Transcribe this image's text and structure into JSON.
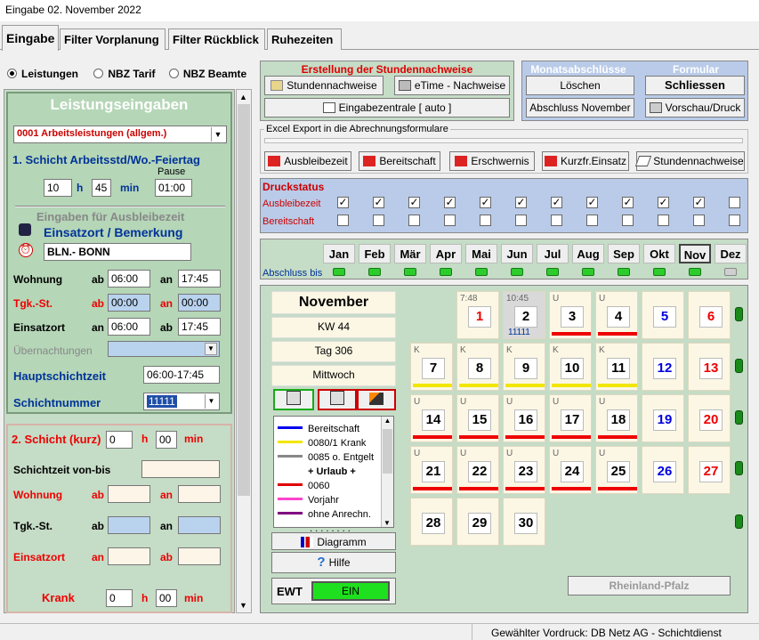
{
  "window": {
    "title": "Eingabe  02. November 2022"
  },
  "tabs": [
    "Eingabe",
    "Filter Vorplanung",
    "Filter Rückblick",
    "Ruhezeiten"
  ],
  "radios": {
    "options": [
      "Leistungen",
      "NBZ Tarif",
      "NBZ Beamte"
    ],
    "selected": "Leistungen"
  },
  "left": {
    "heading": "Leistungseingaben",
    "type_select": "0001 Arbeitsleistungen (allgem.)",
    "schicht1_label": "1. Schicht  Arbeitsstd/Wo.-Feiertag",
    "pause_label": "Pause",
    "hours": "10",
    "h": "h",
    "minutes": "45",
    "min": "min",
    "pause": "01:00",
    "ausbleibe_label": "Eingaben für Ausbleibezeit",
    "einsatzort_label": "Einsatzort / Bemerkung",
    "einsatzort_value": "BLN.- BONN",
    "wohnung": "Wohnung",
    "ab": "ab",
    "an": "an",
    "wohnung_ab": "06:00",
    "wohnung_an": "17:45",
    "tgk": "Tgk.-St.",
    "tgk_ab": "00:00",
    "tgk_an": "00:00",
    "einsatzort": "Einsatzort",
    "einsatz_an": "06:00",
    "einsatz_ab": "17:45",
    "uebernachtungen": "Übernachtungen",
    "hauptschicht": "Hauptschichtzeit",
    "hauptschicht_value": "06:00-17:45",
    "schichtnummer": "Schichtnummer",
    "schichtnummer_value": "11111",
    "schicht2_label": "2. Schicht (kurz)",
    "schicht2_h_val": "0",
    "schicht2_min_val": "00",
    "schichtzeit": "Schichtzeit von-bis",
    "krank": "Krank",
    "krank_h_val": "0",
    "krank_min_val": "00"
  },
  "stundennachweise": {
    "title": "Erstellung der Stundennachweise",
    "btn1": "Stundennachweise",
    "btn2": "eTime - Nachweise",
    "btn3": "Eingabezentrale [ auto  ]"
  },
  "monatsabschluss": {
    "title": "Monatsabschlüsse",
    "loeschen": "Löschen",
    "abschluss": "Abschluss November"
  },
  "formular": {
    "title": "Formular",
    "schliessen": "Schliessen",
    "vorschau": "Vorschau/Druck"
  },
  "excel": {
    "title": "Excel Export in die Abrechnungsformulare",
    "buttons": [
      "Ausbleibezeit",
      "Bereitschaft",
      "Erschwernis",
      "Kurzfr.Einsatz",
      "Stundennachweise"
    ]
  },
  "druckstatus": {
    "title": "Druckstatus",
    "row1": "Ausbleibezeit",
    "row2": "Bereitschaft",
    "ausbleibe_checked": [
      true,
      true,
      true,
      true,
      true,
      true,
      true,
      true,
      true,
      true,
      true,
      false
    ],
    "bereitschaft_checked": [
      false,
      false,
      false,
      false,
      false,
      false,
      false,
      false,
      false,
      false,
      false,
      false
    ]
  },
  "months": {
    "labels": [
      "Jan",
      "Feb",
      "Mär",
      "Apr",
      "Mai",
      "Jun",
      "Jul",
      "Aug",
      "Sep",
      "Okt",
      "Nov",
      "Dez"
    ],
    "abschluss_label": "Abschluss bis",
    "selected": "Nov",
    "closed": [
      true,
      true,
      true,
      true,
      true,
      true,
      true,
      true,
      true,
      true,
      true,
      false
    ]
  },
  "calendar": {
    "month": "November",
    "kw": "KW 44",
    "tag": "Tag 306",
    "weekday": "Mittwoch",
    "days": [
      {
        "d": "1",
        "tag": "7:48",
        "color": "#e00",
        "bar": ""
      },
      {
        "d": "2",
        "tag": "10:45",
        "color": "#000",
        "bar": "",
        "sub": "11111",
        "sel": true
      },
      {
        "d": "3",
        "tag": "U",
        "color": "#000",
        "bar": "#e00"
      },
      {
        "d": "4",
        "tag": "U",
        "color": "#000",
        "bar": "#e00"
      },
      {
        "d": "5",
        "tag": "",
        "color": "#0000dd",
        "bar": ""
      },
      {
        "d": "6",
        "tag": "",
        "color": "#e00",
        "bar": ""
      },
      {
        "d": "7",
        "tag": "K",
        "color": "#000",
        "bar": "#f2e600"
      },
      {
        "d": "8",
        "tag": "K",
        "color": "#000",
        "bar": "#f2e600"
      },
      {
        "d": "9",
        "tag": "K",
        "color": "#000",
        "bar": "#f2e600"
      },
      {
        "d": "10",
        "tag": "K",
        "color": "#000",
        "bar": "#f2e600"
      },
      {
        "d": "11",
        "tag": "K",
        "color": "#000",
        "bar": "#f2e600"
      },
      {
        "d": "12",
        "tag": "",
        "color": "#0000dd",
        "bar": ""
      },
      {
        "d": "13",
        "tag": "",
        "color": "#e00",
        "bar": ""
      },
      {
        "d": "14",
        "tag": "U",
        "color": "#000",
        "bar": "#e00"
      },
      {
        "d": "15",
        "tag": "U",
        "color": "#000",
        "bar": "#e00"
      },
      {
        "d": "16",
        "tag": "U",
        "color": "#000",
        "bar": "#e00"
      },
      {
        "d": "17",
        "tag": "U",
        "color": "#000",
        "bar": "#e00"
      },
      {
        "d": "18",
        "tag": "U",
        "color": "#000",
        "bar": "#e00"
      },
      {
        "d": "19",
        "tag": "",
        "color": "#0000dd",
        "bar": ""
      },
      {
        "d": "20",
        "tag": "",
        "color": "#e00",
        "bar": ""
      },
      {
        "d": "21",
        "tag": "U",
        "color": "#000",
        "bar": "#e00"
      },
      {
        "d": "22",
        "tag": "U",
        "color": "#000",
        "bar": "#e00"
      },
      {
        "d": "23",
        "tag": "U",
        "color": "#000",
        "bar": "#e00"
      },
      {
        "d": "24",
        "tag": "U",
        "color": "#000",
        "bar": "#e00"
      },
      {
        "d": "25",
        "tag": "U",
        "color": "#000",
        "bar": "#e00"
      },
      {
        "d": "26",
        "tag": "",
        "color": "#0000dd",
        "bar": ""
      },
      {
        "d": "27",
        "tag": "",
        "color": "#e00",
        "bar": ""
      },
      {
        "d": "28",
        "tag": "",
        "color": "#000",
        "bar": ""
      },
      {
        "d": "29",
        "tag": "",
        "color": "#000",
        "bar": ""
      },
      {
        "d": "30",
        "tag": "",
        "color": "#000",
        "bar": ""
      }
    ],
    "legend": [
      {
        "label": "Bereitschaft",
        "color": "#0000ee"
      },
      {
        "label": "0080/1 Krank",
        "color": "#f2e600"
      },
      {
        "label": "0085 o. Entgelt",
        "color": "#888888"
      },
      {
        "label": "+ Urlaub +",
        "color": ""
      },
      {
        "label": "0060",
        "color": "#e00000"
      },
      {
        "label": "Vorjahr",
        "color": "#ff44cc"
      },
      {
        "label": "ohne Anrechn.",
        "color": "#800080"
      }
    ],
    "diagramm": "Diagramm",
    "hilfe": "Hilfe",
    "ewt": "EWT",
    "ewt_state": "EIN",
    "region": "Rheinland-Pfalz"
  },
  "status": {
    "text": "Gewählter Vordruck: DB Netz AG - Schichtdienst"
  }
}
